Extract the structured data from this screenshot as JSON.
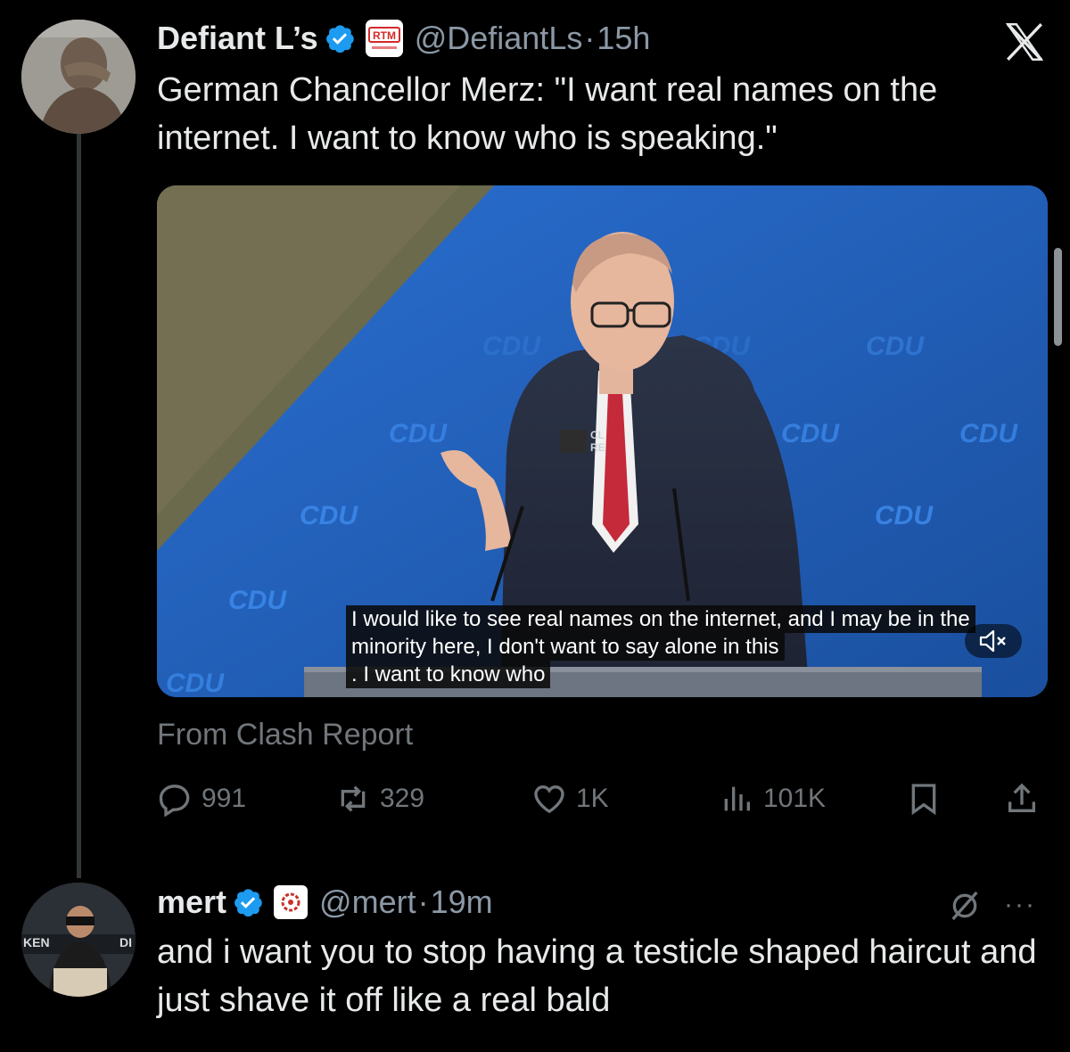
{
  "colors": {
    "background": "#000000",
    "text": "#e7e9ea",
    "muted": "#71767b",
    "verified": "#1d9bf0",
    "cdu_blue": "#1e5fb8"
  },
  "tweet": {
    "author_name": "Defiant L’s",
    "affiliate_badge": "RTM",
    "handle": "@DefiantLs",
    "separator": "·",
    "time": "15h",
    "text": "German Chancellor Merz:  \"I want real names on the internet. I want to know who is speaking.\"",
    "media": {
      "stage_logo": "CDU",
      "subtitle_lines": [
        "I would like to see real names on the internet, and I may be in the",
        "minority here, I don't want to say alone in this",
        ". I want to know who"
      ],
      "mute_icon": "speaker-muted-icon"
    },
    "source_label": "From Clash Report",
    "actions": {
      "replies": "991",
      "reposts": "329",
      "likes": "1K",
      "views": "101K"
    }
  },
  "reply": {
    "author_name": "mert",
    "handle": "@mert",
    "separator": "·",
    "time": "19m",
    "text": "and i want you to stop having a testicle shaped haircut and just shave it off like a real bald",
    "more": "···"
  },
  "icons": [
    "x-logo-icon",
    "verified-icon",
    "reply-icon",
    "repost-icon",
    "like-icon",
    "views-icon",
    "bookmark-icon",
    "share-icon",
    "grok-icon",
    "more-icon"
  ]
}
